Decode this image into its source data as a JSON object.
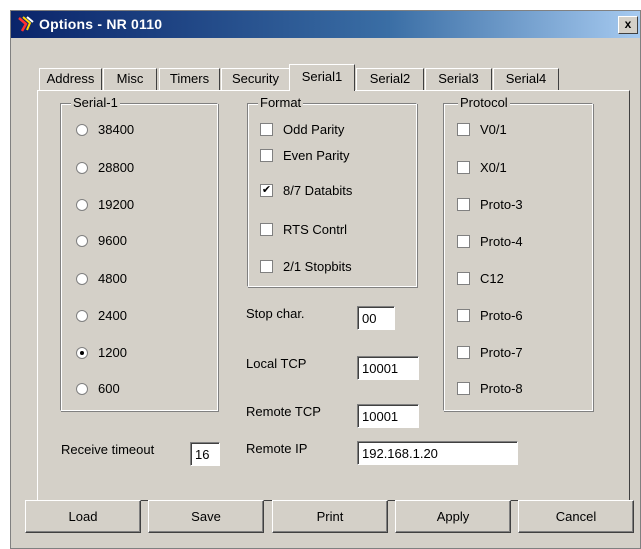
{
  "window": {
    "title": "Options - NR 0110",
    "close_glyph": "x"
  },
  "tabs": [
    "Address",
    "Misc",
    "Timers",
    "Security",
    "Serial1",
    "Serial2",
    "Serial3",
    "Serial4"
  ],
  "active_tab": "Serial1",
  "baud_group": {
    "legend": "Serial-1",
    "options": [
      "38400",
      "28800",
      "19200",
      "9600",
      "4800",
      "2400",
      "1200",
      "600"
    ],
    "selected": "1200"
  },
  "format_group": {
    "legend": "Format",
    "options": [
      {
        "label": "Odd Parity",
        "checked": false
      },
      {
        "label": "Even Parity",
        "checked": false
      },
      {
        "label": "8/7 Databits",
        "checked": true
      },
      {
        "label": "RTS Contrl",
        "checked": false
      },
      {
        "label": "2/1 Stopbits",
        "checked": false
      }
    ]
  },
  "protocol_group": {
    "legend": "Protocol",
    "options": [
      {
        "label": "V0/1",
        "checked": false
      },
      {
        "label": "X0/1",
        "checked": false
      },
      {
        "label": "Proto-3",
        "checked": false
      },
      {
        "label": "Proto-4",
        "checked": false
      },
      {
        "label": "C12",
        "checked": false
      },
      {
        "label": "Proto-6",
        "checked": false
      },
      {
        "label": "Proto-7",
        "checked": false
      },
      {
        "label": "Proto-8",
        "checked": false
      }
    ]
  },
  "fields": {
    "stop_char": {
      "label": "Stop char.",
      "value": "00"
    },
    "local_tcp": {
      "label": "Local TCP",
      "value": "10001"
    },
    "remote_tcp": {
      "label": "Remote TCP",
      "value": "10001"
    },
    "remote_ip": {
      "label": "Remote IP",
      "value": "192.168.1.20"
    },
    "receive_timeout": {
      "label": "Receive timeout",
      "value": "16"
    }
  },
  "buttons": {
    "load": "Load",
    "save": "Save",
    "print": "Print",
    "apply": "Apply",
    "cancel": "Cancel"
  },
  "colors": {
    "face": "#d4d0c8",
    "title_start": "#0a246a",
    "title_end": "#a6caf0"
  }
}
